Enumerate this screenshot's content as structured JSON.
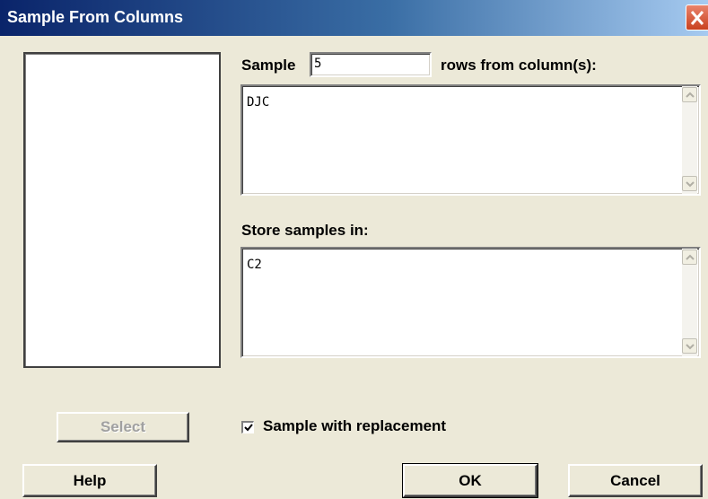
{
  "window": {
    "title": "Sample From Columns"
  },
  "sample": {
    "label_before": "Sample",
    "count_value": "5",
    "label_after": "rows from column(s):",
    "columns_value": "DJC"
  },
  "store": {
    "label": "Store samples in:",
    "value": "C2"
  },
  "replacement": {
    "label": "Sample with replacement",
    "checked": true
  },
  "buttons": {
    "select": "Select",
    "help": "Help",
    "ok": "OK",
    "cancel": "Cancel"
  },
  "icons": {
    "close": "close-icon",
    "check": "checkmark-icon",
    "scroll_up": "chevron-up-icon",
    "scroll_down": "chevron-down-icon"
  }
}
